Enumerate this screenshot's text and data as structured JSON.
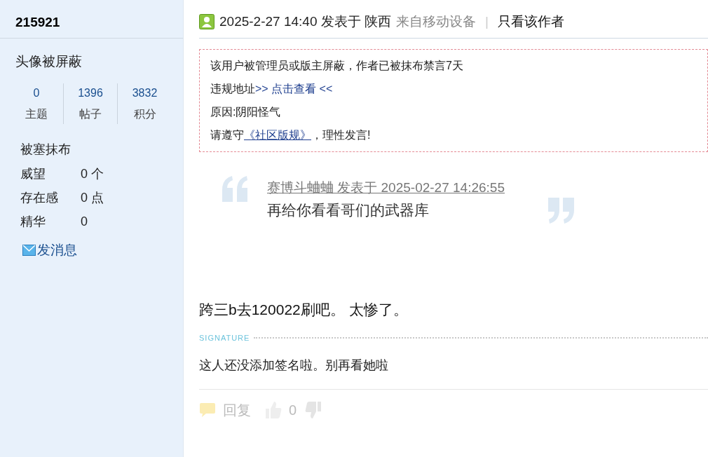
{
  "sidebar": {
    "username": "215921",
    "avatar_text": "头像被屏蔽",
    "stats": [
      {
        "value": "0",
        "label": "主题"
      },
      {
        "value": "1396",
        "label": "帖子"
      },
      {
        "value": "3832",
        "label": "积分"
      }
    ],
    "group": "被塞抹布",
    "fields": [
      {
        "label": "威望",
        "value": "0 个"
      },
      {
        "label": "存在感",
        "value": "0 点"
      },
      {
        "label": "精华",
        "value": "0"
      }
    ],
    "message_link": "发消息"
  },
  "post": {
    "posted": "2025-2-27 14:40 发表于 陕西",
    "device": "来自移动设备",
    "separator": "|",
    "only_author": "只看该作者",
    "notice": [
      {
        "text": "该用户被管理员或版主屏蔽，作者已被抹布禁言7天"
      },
      {
        "text": "违规地址",
        "link": ">> 点击查看 <<"
      },
      {
        "text": "原因:阴阳怪气"
      },
      {
        "text": "请遵守",
        "link": "《社区版规》",
        "after": "，理性发言!"
      }
    ],
    "quote": {
      "author_line": "赛博斗蛐蛐 发表于 2025-02-27 14:26:55",
      "text": "再给你看看哥们的武器库"
    },
    "body": "跨三b去120022刷吧。 太惨了。",
    "signature_label": "SIGNATURE",
    "signature": "这人还没添加签名啦。别再看她啦",
    "actions": {
      "reply": "回复",
      "likes": "0"
    }
  }
}
